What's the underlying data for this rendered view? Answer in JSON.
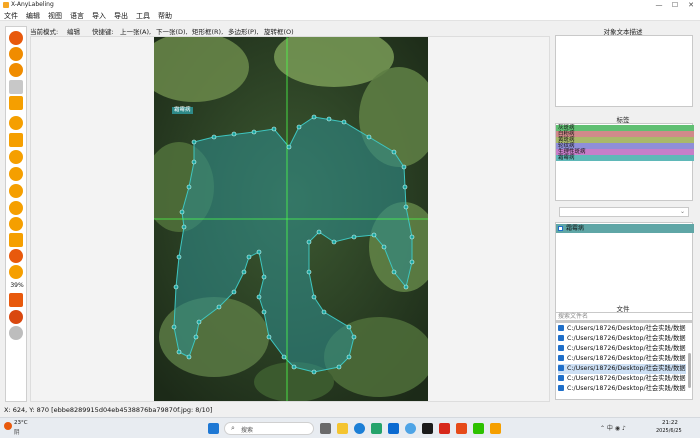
{
  "window": {
    "title": "X-AnyLabeling",
    "min": "—",
    "max": "☐",
    "close": "✕"
  },
  "menu": [
    "文件",
    "编辑",
    "视图",
    "语言",
    "导入",
    "导出",
    "工具",
    "帮助"
  ],
  "mode": {
    "current_label": "当前模式:",
    "current_value": "编辑",
    "shortcut_label": "快捷键:",
    "shortcuts": [
      "上一张(A),",
      "下一张(D),",
      "矩形框(R),",
      "多边形(P),",
      "旋转框(O)"
    ]
  },
  "canvas": {
    "shape_label": "霜霉病"
  },
  "toolbar": {
    "zoom": "39%"
  },
  "right": {
    "object_text_title": "对象文本描述",
    "labels_title": "标签",
    "label_items": [
      {
        "text": "灰斑病",
        "color": "#5fbf72"
      },
      {
        "text": "白粉病",
        "color": "#d08a8a"
      },
      {
        "text": "黄斑病",
        "color": "#a9b96a"
      },
      {
        "text": "轮纹病",
        "color": "#8f8fd8"
      },
      {
        "text": "生理性斑病",
        "color": "#c77ec9"
      },
      {
        "text": "霜霉病",
        "color": "#5fb8b8"
      }
    ],
    "shape_list": [
      {
        "text": "霜霉病",
        "color": "#5fa6a6"
      }
    ],
    "files_title": "文件",
    "search_placeholder": "搜索文件名",
    "files": [
      "C:/Users/18726/Desktop/社会实践/数据",
      "C:/Users/18726/Desktop/社会实践/数据",
      "C:/Users/18726/Desktop/社会实践/数据",
      "C:/Users/18726/Desktop/社会实践/数据",
      "C:/Users/18726/Desktop/社会实践/数据",
      "C:/Users/18726/Desktop/社会实践/数据",
      "C:/Users/18726/Desktop/社会实践/数据"
    ]
  },
  "status": {
    "text": "X: 624, Y: 870 [ebbe8289915d04eb4538876ba79870f.jpg: 8/10]"
  },
  "taskbar": {
    "weather_temp": "23°C",
    "weather_desc": "阴",
    "search": "搜索",
    "time": "21:22",
    "date": "2025/6/25"
  }
}
